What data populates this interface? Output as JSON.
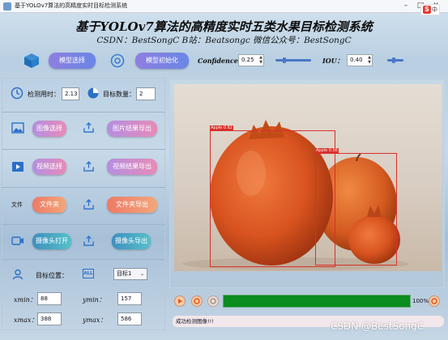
{
  "window": {
    "title": "基于YOLOv7算法的高精度实时目标检测系统"
  },
  "brand": {
    "logo_letter": "S",
    "logo_text": "中"
  },
  "header": {
    "title": "基于YOLOv7算法的高精度实时五类水果目标检测系统",
    "subtitle": "CSDN：BestSongC   B站：Beatsongc   微信公众号：BestSongC"
  },
  "toolbar": {
    "model_select_label": "模型选择",
    "model_init_label": "模型初始化",
    "confidence_label": "Confidence",
    "confidence_value": "0.25",
    "confidence_level": 0.25,
    "iou_label": "IOU：",
    "iou_value": "0.40",
    "iou_level": 0.4
  },
  "stats": {
    "time_label": "检测用时：",
    "time_value": "2.13",
    "count_label": "目标数量：",
    "count_value": "2"
  },
  "actions": {
    "image_select": "图像选择",
    "image_export": "图片结果导出",
    "video_select": "视频选择",
    "video_export": "视频结果导出",
    "folder_icon_text": "文件",
    "folder_select": "文件夹",
    "folder_export": "文件夹导出",
    "camera_open": "摄像头打开",
    "camera_export": "摄像头导出"
  },
  "target": {
    "position_label": "目标位置：",
    "all_label": "ALL",
    "select_value": "目标1",
    "xmin_label": "xmin：",
    "xmin_value": "88",
    "ymin_label": "ymin：",
    "ymin_value": "157",
    "xmax_label": "xmax：",
    "xmax_value": "388",
    "ymax_label": "ymax：",
    "ymax_value": "586"
  },
  "detections": [
    {
      "label": "Apple  0.82"
    },
    {
      "label": "Apple  0.56"
    }
  ],
  "player": {
    "progress_text": "100%",
    "progress": 1.0
  },
  "status": {
    "message": "成功检测图像!!!"
  },
  "watermark": {
    "text": "CSDN @BestSongC"
  },
  "colors": {
    "accent": "#4a78c7",
    "progress": "#0a8c1e",
    "box": "#d8302a"
  }
}
